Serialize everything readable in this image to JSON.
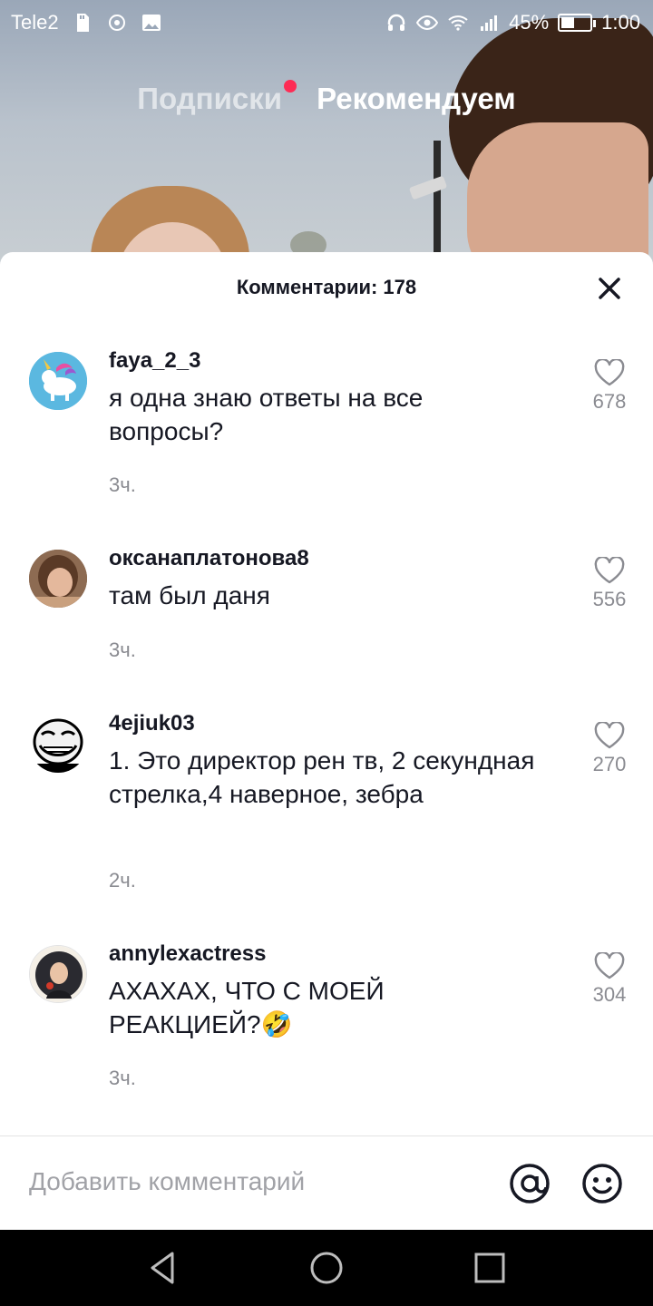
{
  "status_bar": {
    "carrier": "Tele2",
    "battery_percent": "45%",
    "battery_level": 0.45,
    "time": "1:00"
  },
  "top_tabs": {
    "following": "Подписки",
    "for_you": "Рекомендуем"
  },
  "comments_sheet": {
    "title": "Комментарии: 178",
    "comments": [
      {
        "user": "faya_2_3",
        "text": "я одна знаю ответы на все вопросы?",
        "time": "3ч.",
        "likes": "678"
      },
      {
        "user": "оксанаплатонова8",
        "text": "там был даня",
        "time": "3ч.",
        "likes": "556"
      },
      {
        "user": "4ejiuk03",
        "text": "1. Это директор рен тв, 2 секундная стрелка,4 наверное, зебра",
        "time": "2ч.",
        "likes": "270"
      },
      {
        "user": "annylexactress",
        "text": "АХАХАХ, ЧТО С МОЕЙ РЕАКЦИЕЙ?🤣",
        "time": "3ч.",
        "likes": "304"
      }
    ]
  },
  "input": {
    "placeholder": "Добавить комментарий"
  },
  "icons": {
    "close": "close-icon",
    "like": "heart-icon",
    "mention": "at-icon",
    "emoji": "smiley-icon"
  },
  "colors": {
    "accent": "#fe2c55",
    "text_primary": "#161823",
    "text_secondary": "#8a8b91"
  }
}
